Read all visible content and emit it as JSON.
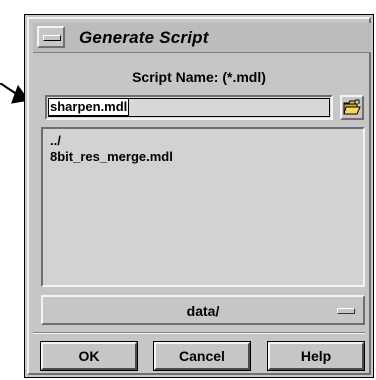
{
  "window": {
    "title": "Generate Script"
  },
  "dialog": {
    "script_name_label": "Script Name: (*.mdl)",
    "script_name_value": "sharpen.mdl",
    "files": [
      "../",
      "8bit_res_merge.mdl"
    ],
    "directory": "data/"
  },
  "buttons": {
    "ok": "OK",
    "cancel": "Cancel",
    "help": "Help"
  },
  "icons": {
    "window_menu": "window-menu-icon",
    "open_folder": "open-folder-icon",
    "pointer": "pointer-arrow-icon",
    "option_menu": "option-menu-indicator-icon"
  }
}
